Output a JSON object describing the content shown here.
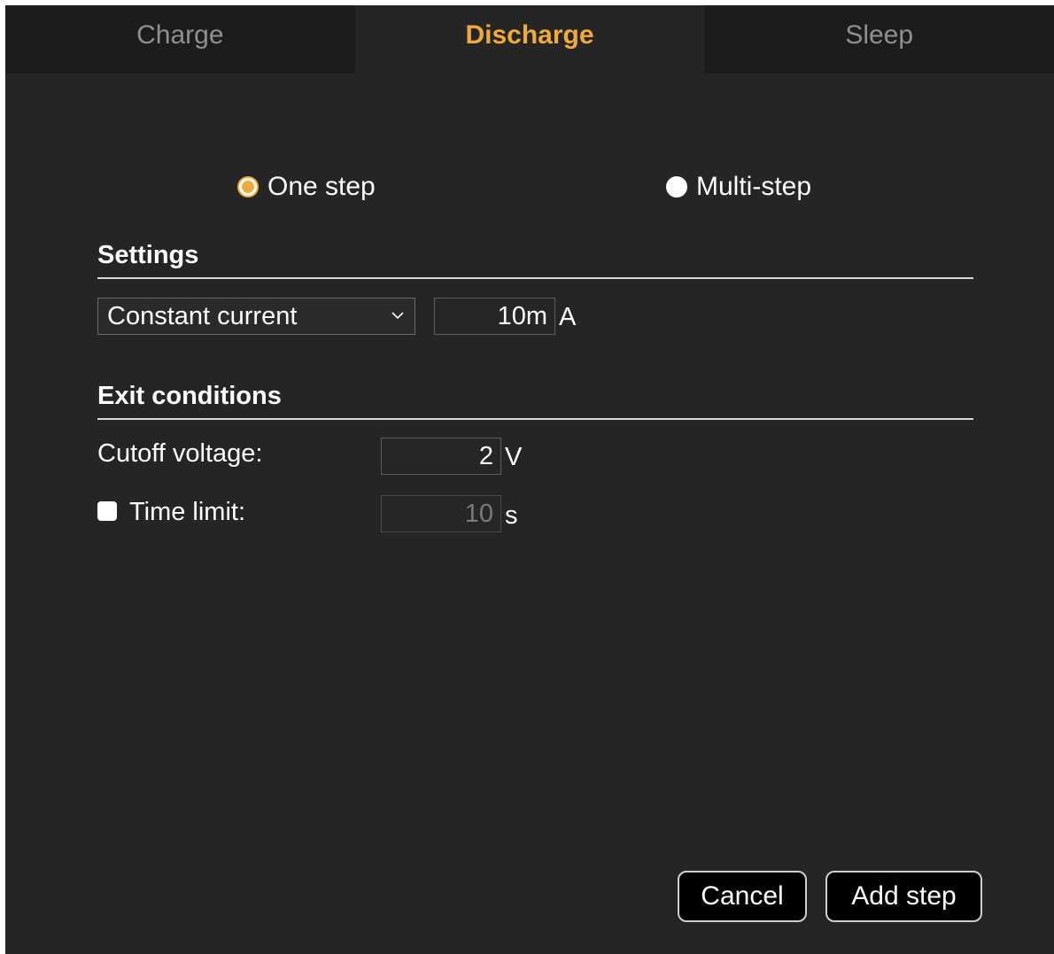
{
  "tabs": [
    {
      "label": "Charge",
      "active": false
    },
    {
      "label": "Discharge",
      "active": true
    },
    {
      "label": "Sleep",
      "active": false
    }
  ],
  "mode": {
    "one_step_label": "One step",
    "multi_step_label": "Multi-step",
    "selected": "One step"
  },
  "settings": {
    "title": "Settings",
    "mode_select_value": "Constant current",
    "current_value": "10m",
    "current_unit": "A"
  },
  "exit": {
    "title": "Exit conditions",
    "cutoff_label": "Cutoff voltage:",
    "cutoff_value": "2",
    "cutoff_unit": "V",
    "time_limit_label": "Time limit:",
    "time_limit_checked": false,
    "time_limit_value": "10",
    "time_limit_unit": "s"
  },
  "buttons": {
    "cancel": "Cancel",
    "add_step": "Add step"
  },
  "colors": {
    "accent": "#f2a93b",
    "panel_bg": "#252525",
    "tab_inactive_bg": "#1c1c1c"
  }
}
